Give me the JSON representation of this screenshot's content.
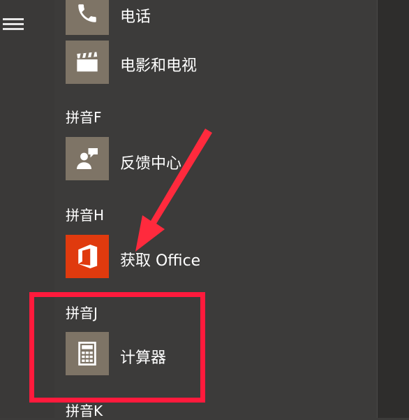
{
  "apps": {
    "phone": {
      "label": "电话",
      "icon": "phone-icon"
    },
    "movies": {
      "label": "电影和电视",
      "icon": "clapperboard-icon"
    },
    "feedback": {
      "label": "反馈中心",
      "icon": "feedback-person-icon"
    },
    "office": {
      "label": "获取 Office",
      "icon": "office-logo-icon"
    },
    "calculator": {
      "label": "计算器",
      "icon": "calculator-icon"
    }
  },
  "groups": {
    "f": "拼音F",
    "h": "拼音H",
    "j": "拼音J",
    "k": "拼音K"
  },
  "colors": {
    "tile_bg": "#7e7466",
    "office_bg": "#e03a0e",
    "annotation_red": "#ff1a3c",
    "menu_bg": "#3c3b3a"
  }
}
